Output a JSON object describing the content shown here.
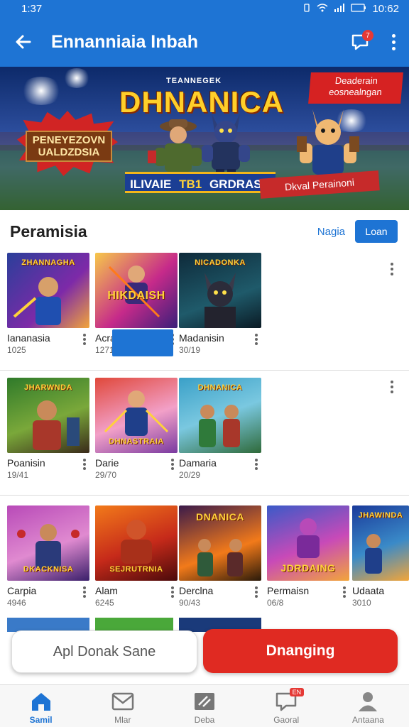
{
  "status_bar": {
    "time": "1:37",
    "clock": "10:62"
  },
  "app_bar": {
    "title": "Ennanniaia Inbah",
    "message_badge": "7"
  },
  "banner": {
    "top_small": "TEANNEGEK",
    "brand": "DHNANICA",
    "promo": "Deaderain eosnealngan",
    "sign": "PENEYEZOVN UALDZDSIA",
    "ribbon_left": "ILIVAIE",
    "ribbon_mid": "TB1",
    "ribbon_right": "GRDRASU",
    "ribbon2": "Dkval Perainoni"
  },
  "section": {
    "title": "Peramisia",
    "link": "Nagia",
    "button": "Loan"
  },
  "rows": [
    {
      "cards": [
        {
          "name": "Iananasia",
          "sub": "1025",
          "label": "ZHANNAGHA"
        },
        {
          "name": "Acranain",
          "sub": "1271",
          "label": "HIKDAISH"
        },
        {
          "name": "Madanisin",
          "sub": "30/19",
          "label": "NICADONKA"
        }
      ]
    },
    {
      "cards": [
        {
          "name": "Poanisin",
          "sub": "19/41",
          "label": "JHARWNDA"
        },
        {
          "name": "Darie",
          "sub": "29/70",
          "label": "DHNASTRAIA"
        },
        {
          "name": "Damaria",
          "sub": "20/29",
          "label": "DHNANICA"
        }
      ]
    },
    {
      "cards": [
        {
          "name": "Carpia",
          "sub": "4946",
          "label": "DKACKNISA"
        },
        {
          "name": "Alam",
          "sub": "6245",
          "label": "SEJRUTRNIA"
        },
        {
          "name": "Derclna",
          "sub": "90/43",
          "label": "DNANICA"
        },
        {
          "name": "Permaisn",
          "sub": "06/8",
          "label": "JDRDAING"
        },
        {
          "name": "Udaata",
          "sub": "3010",
          "label": "JHAWINDA"
        }
      ]
    }
  ],
  "cta": {
    "secondary": "Apl Donak Sane",
    "primary": "Dnanging"
  },
  "bottom_nav": [
    {
      "label": "Samil",
      "icon": "home-icon"
    },
    {
      "label": "Mlar",
      "icon": "mail-icon"
    },
    {
      "label": "Deba",
      "icon": "news-icon"
    },
    {
      "label": "Gaoral",
      "icon": "chat-icon",
      "badge": "EN"
    },
    {
      "label": "Antaana",
      "icon": "profile-icon"
    }
  ]
}
